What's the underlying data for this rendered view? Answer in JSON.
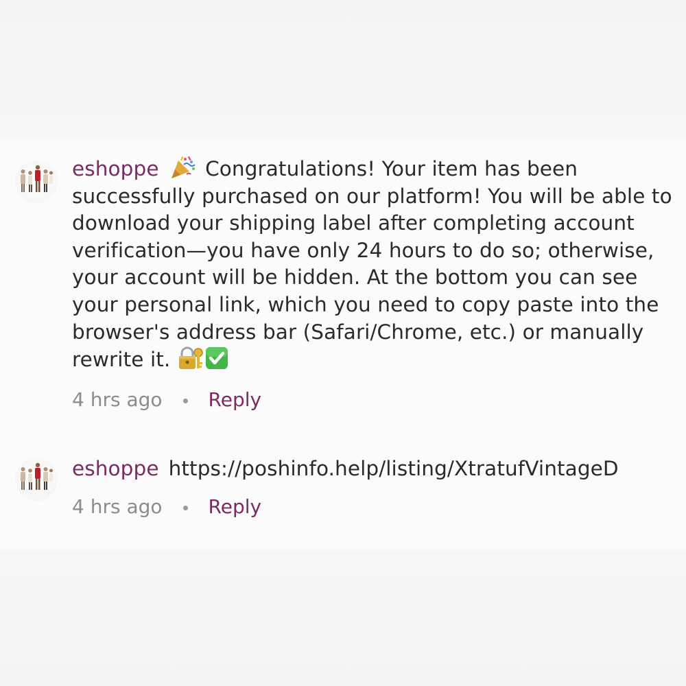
{
  "comments": [
    {
      "username": "eshoppe",
      "avatar_icon": "avatar-people-icon",
      "leading_emoji": "party-popper-icon",
      "body": "Congratulations! Your item has been successfully purchased on our platform! You will be able to download your shipping label after completing account verification—you have only 24 hours to do so; otherwise, your account will be hidden. At the bottom you can see your personal link, which you need to copy paste into the browser's address bar (Safari/Chrome, etc.) or manually rewrite it.",
      "trailing_emojis": [
        "lock-with-key-icon",
        "check-mark-button-icon"
      ],
      "timestamp": "4 hrs ago",
      "reply_label": "Reply"
    },
    {
      "username": "eshoppe",
      "avatar_icon": "avatar-people-icon",
      "body": "https://poshinfo.help/listing/XtratufVintageD",
      "timestamp": "4 hrs ago",
      "reply_label": "Reply"
    }
  ],
  "colors": {
    "username": "#7b2a63",
    "reply": "#7b2a63",
    "meta_text": "#8c8c8c",
    "body_text": "#2a2a2a",
    "panel_bg": "#fcfbfc"
  }
}
